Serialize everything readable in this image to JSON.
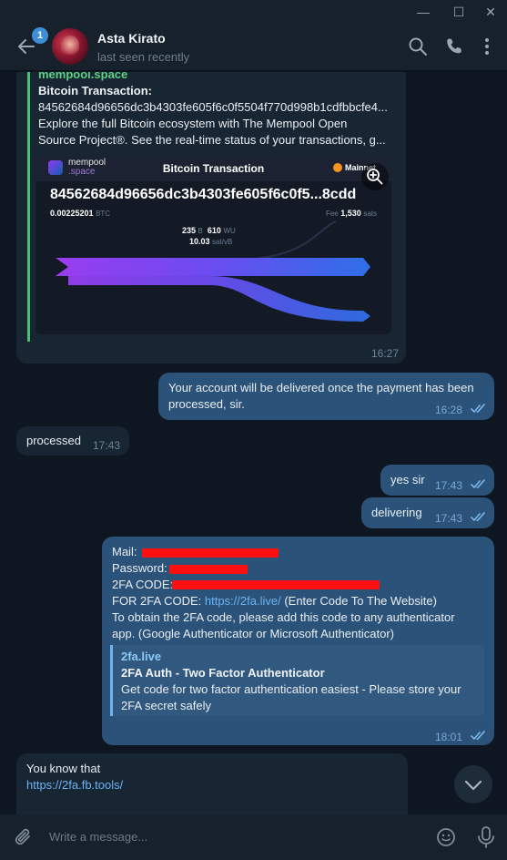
{
  "window": {
    "minimize_glyph": "—",
    "maximize_glyph": "☐",
    "close_glyph": "✕"
  },
  "header": {
    "unread_count": "1",
    "contact_name": "Asta Kirato",
    "contact_status": "last seen recently",
    "icons": [
      "back-arrow-icon",
      "search-icon",
      "phone-icon",
      "more-vertical-icon"
    ]
  },
  "messages": {
    "mempool": {
      "site": "mempool.space",
      "title": "Bitcoin Transaction:",
      "line1": "84562684d96656dc3b4303fe605f6c0f5504f770d998b1cdfbbcfe4...",
      "line2": "Explore the full Bitcoin ecosystem with The Mempool Open",
      "line3": "Source Project®. See the real-time status of your transactions, g...",
      "time": "16:27",
      "card": {
        "brand_line1": "mempool",
        "brand_line2": ".space",
        "title": "Bitcoin Transaction",
        "network": "Mainnet",
        "hash": "84562684d96656dc3b4303fe605f6c0f5...8cdd",
        "amount": "0.00225201",
        "amount_unit": "BTC",
        "fee_label": "Fee",
        "fee": "1,530",
        "fee_unit": "sats",
        "size": "235",
        "size_unit": "B",
        "weight": "610",
        "weight_unit": "WU",
        "rate": "10.03",
        "rate_unit": "sat/vB"
      }
    },
    "m2": {
      "text1": "Your account will be delivered once the payment has been",
      "text2": "processed, sir.",
      "time": "16:28"
    },
    "m3": {
      "text": "processed",
      "time": "17:43"
    },
    "m4": {
      "text": "yes sir",
      "time": "17:43"
    },
    "m5": {
      "text": "delivering",
      "time": "17:43"
    },
    "m6": {
      "mail_label": "Mail:",
      "password_label": "Password:",
      "code_label": "2FA CODE:",
      "for_label": "FOR 2FA CODE:",
      "for_link": "https://2fa.live/",
      "for_rest": "(Enter Code To The Website)",
      "line5": "To obtain the 2FA code, please add this code to any authenticator",
      "line6": "app. (Google Authenticator or Microsoft Authenticator)",
      "preview_site": "2fa.live",
      "preview_title": "2FA Auth - Two Factor Authenticator",
      "preview_desc1": "Get code for two factor authentication easiest - Please store your",
      "preview_desc2": "2FA secret safely",
      "time": "18:01"
    },
    "m7": {
      "text": "You know that",
      "link": "https://2fa.fb.tools/"
    }
  },
  "composer": {
    "placeholder": "Write a message...",
    "icons": [
      "paperclip-icon",
      "emoji-icon",
      "microphone-icon"
    ]
  },
  "colors": {
    "background": "#0e1621",
    "incoming_bubble": "#182533",
    "outgoing_bubble": "#2b5278",
    "link": "#6ab3f3",
    "redaction": "#ff1010"
  }
}
